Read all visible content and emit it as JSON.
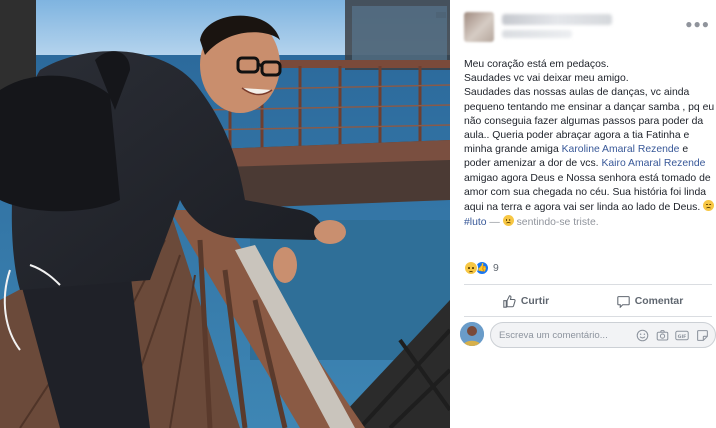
{
  "post": {
    "lines": [
      "Meu coração está em pedaços.",
      "Saudades vc vai deixar meu amigo.",
      "Saudades das nossas aulas de danças, vc ainda pequeno tentando me ensinar a dançar samba , pq eu não conseguia fazer algumas passos para poder da aula.. Queria poder abraçar agora a tia Fatinha e minha grande amiga "
    ],
    "mention_1": "Karoline Amaral Rezende",
    "text_after_mention_1": " e poder amenizar a dor de vcs. ",
    "mention_2": "Kairo Amaral Rezende",
    "text_after_mention_2": " amigao agora Deus e Nossa senhora está tomado de amor com sua chegada no céu. Sua história foi linda aqui na terra e agora vai ser linda ao lado de Deus. ",
    "hashtag": "#luto",
    "feeling_separator": " — ",
    "feeling": " sentindo-se triste."
  },
  "reactions": {
    "count": "9",
    "types": [
      "sad",
      "like"
    ]
  },
  "actions": {
    "like_label": "Curtir",
    "comment_label": "Comentar"
  },
  "comment_box": {
    "placeholder": "Escreva um comentário..."
  },
  "colors": {
    "link": "#385898",
    "text": "#1d2129",
    "muted": "#606770",
    "like_blue": "#1877f2"
  },
  "icons": [
    "more-options-icon",
    "sad-reaction-icon",
    "like-reaction-icon",
    "thumbs-up-icon",
    "comment-bubble-icon",
    "emoji-icon",
    "camera-icon",
    "gif-icon",
    "sticker-icon"
  ]
}
